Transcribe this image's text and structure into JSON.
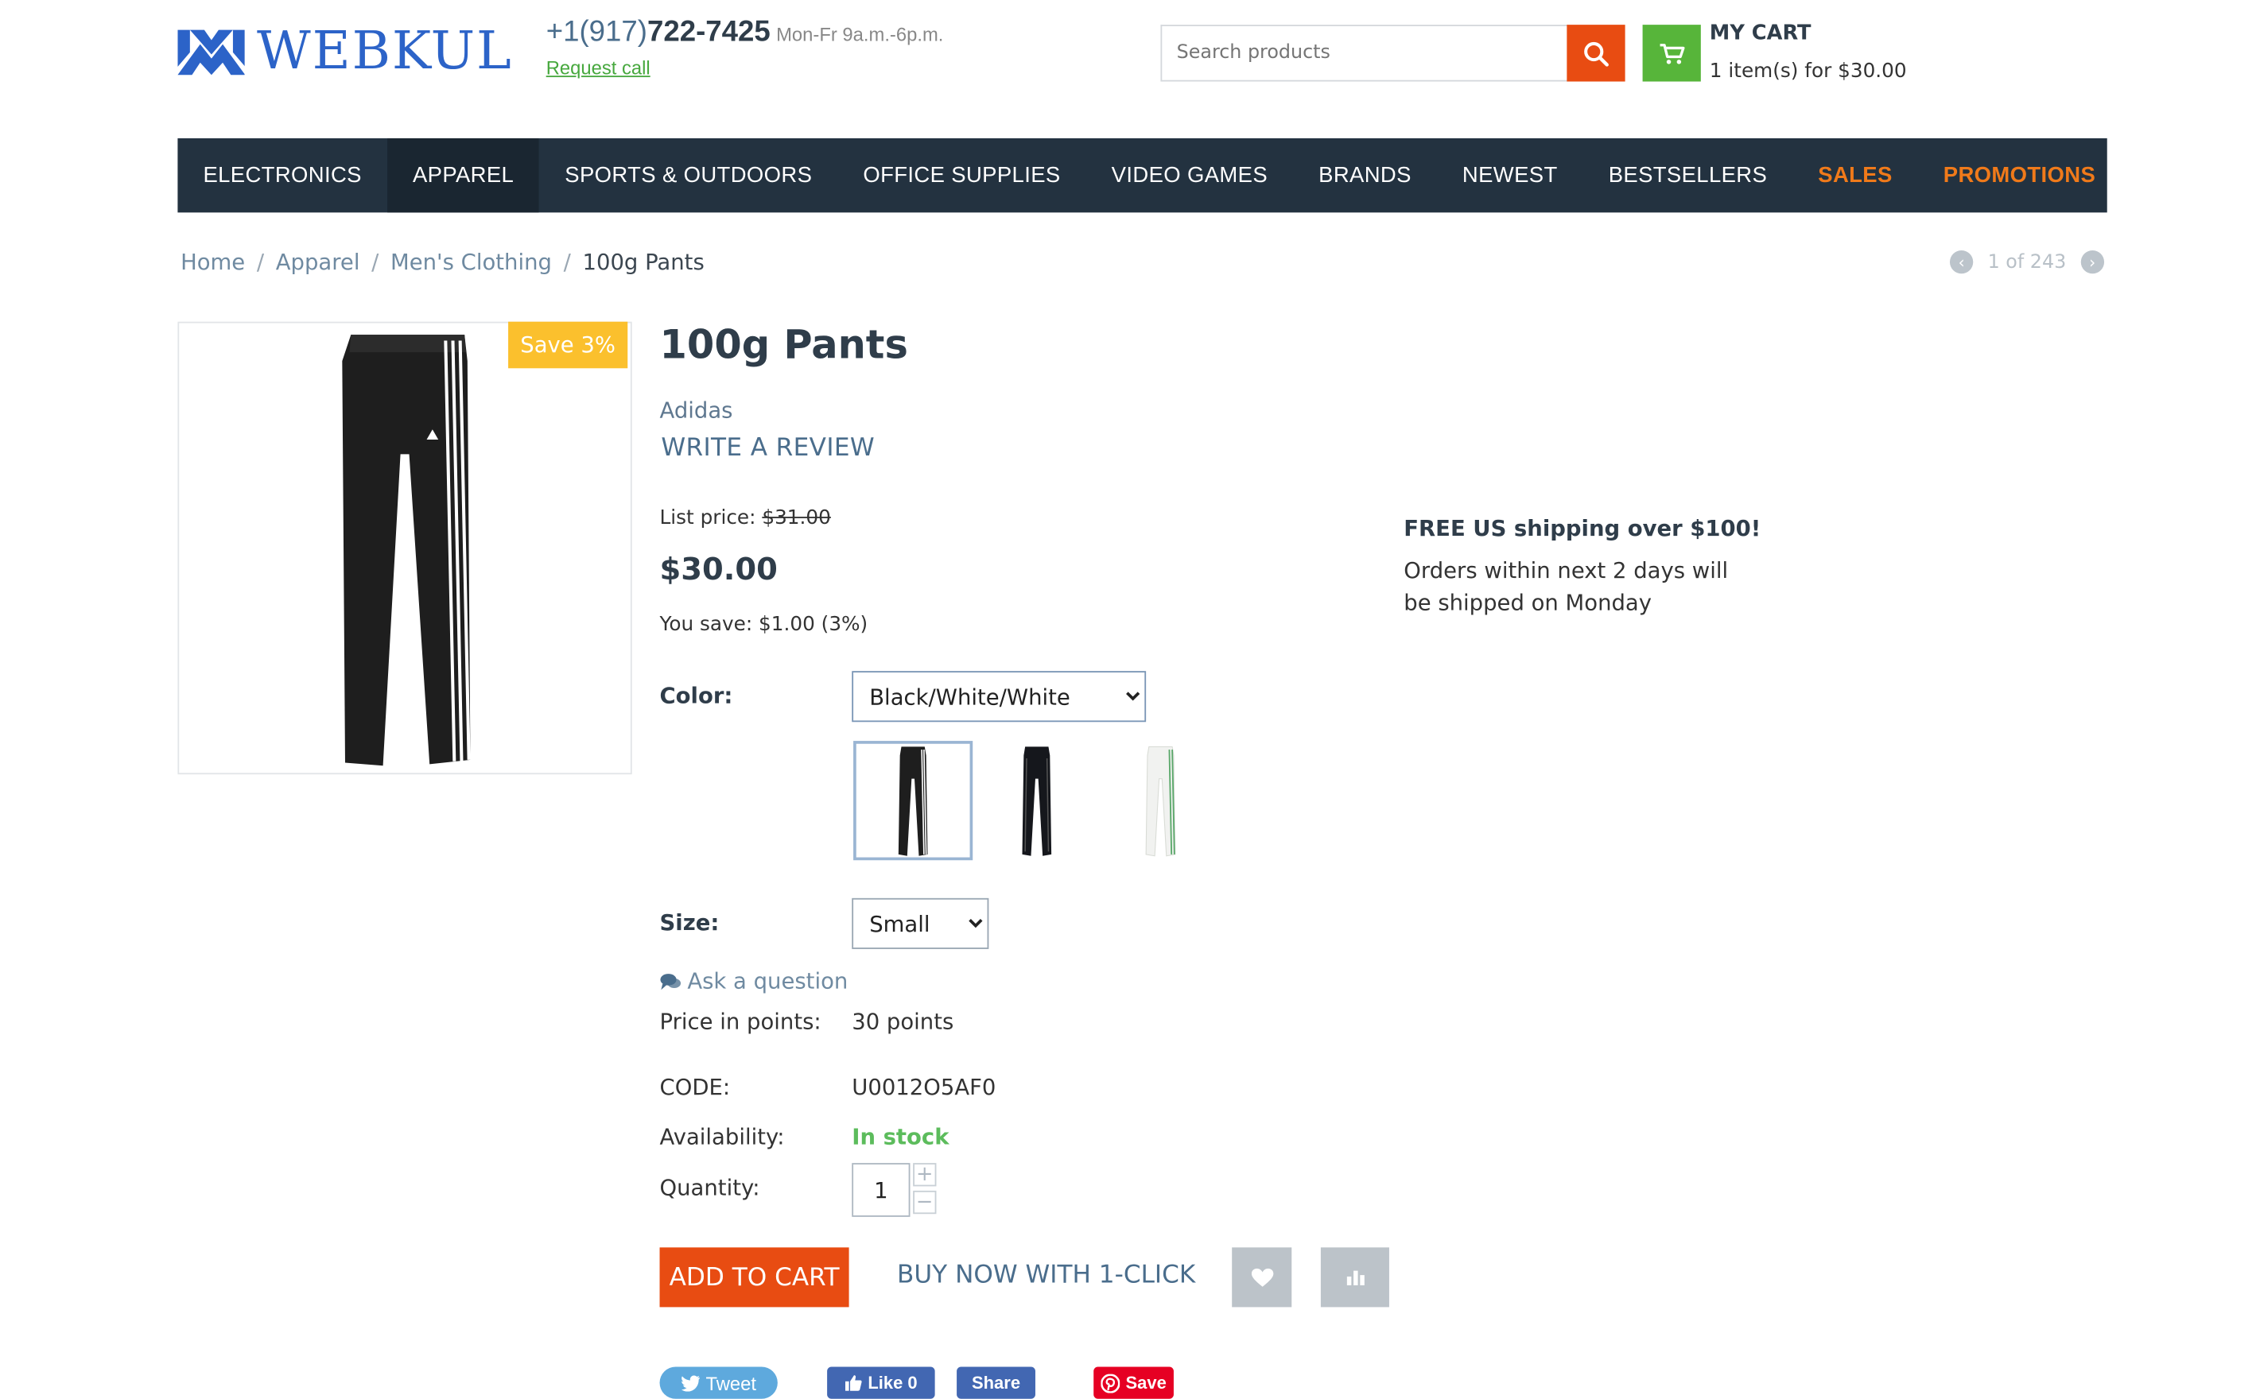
{
  "header": {
    "logo_text": "WEBKUL",
    "phone_prefix": "+1(917)",
    "phone_number": "722-7425",
    "hours": "Mon-Fr 9a.m.-6p.m.",
    "request_call": "Request call",
    "search_placeholder": "Search products",
    "cart_title": "MY CART",
    "cart_summary": "1 item(s) for $30.00"
  },
  "nav": {
    "items": [
      {
        "label": "ELECTRONICS"
      },
      {
        "label": "APPAREL"
      },
      {
        "label": "SPORTS & OUTDOORS"
      },
      {
        "label": "OFFICE SUPPLIES"
      },
      {
        "label": "VIDEO GAMES"
      },
      {
        "label": "BRANDS"
      },
      {
        "label": "NEWEST"
      },
      {
        "label": "BESTSELLERS"
      },
      {
        "label": "SALES"
      },
      {
        "label": "PROMOTIONS"
      }
    ],
    "active_item": "APPAREL",
    "highlight_color": "#f07a1a",
    "background_color": "#233240"
  },
  "breadcrumb": {
    "items": [
      "Home",
      "Apparel",
      "Men's Clothing"
    ],
    "separator": "/",
    "current": "100g Pants"
  },
  "pager": {
    "text": "1 of 243"
  },
  "product": {
    "save_badge": "Save 3%",
    "title": "100g Pants",
    "brand": "Adidas",
    "write_review": "WRITE A REVIEW",
    "list_price_label": "List price:",
    "list_price": "$31.00",
    "price": "$30.00",
    "you_save": "You save: $1.00 (3%)",
    "color_label": "Color:",
    "color_selected": "Black/White/White",
    "color_swatches": [
      {
        "name": "Black/White/White",
        "selected": true
      },
      {
        "name": "Black",
        "selected": false
      },
      {
        "name": "White",
        "selected": false
      }
    ],
    "size_label": "Size:",
    "size_selected": "Small",
    "ask_question": "Ask a question",
    "points_label": "Price in points:",
    "points_value": "30 points",
    "code_label": "CODE:",
    "code_value": "U0012O5AF0",
    "availability_label": "Availability:",
    "availability_value": "In stock",
    "quantity_label": "Quantity:",
    "quantity_value": "1",
    "add_to_cart": "ADD TO CART",
    "buy_now": "BUY NOW WITH 1-CLICK",
    "accent_color": "#e84c12"
  },
  "shipping": {
    "title": "FREE US shipping over $100!",
    "text": "Orders within next 2 days will be shipped on Monday"
  },
  "social": {
    "tweet": "Tweet",
    "like": "Like 0",
    "share": "Share",
    "save": "Save"
  }
}
